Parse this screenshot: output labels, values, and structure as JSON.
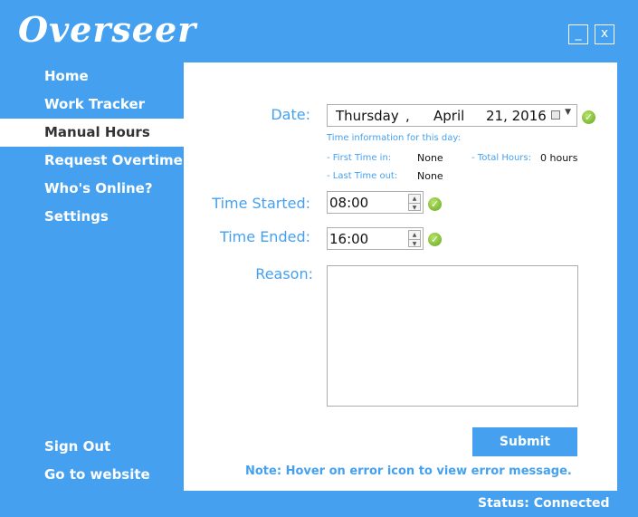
{
  "app": {
    "title": "Overseer"
  },
  "window": {
    "minimize": "_",
    "close": "x"
  },
  "nav": {
    "items": [
      {
        "label": "Home"
      },
      {
        "label": "Work Tracker"
      },
      {
        "label": "Manual Hours"
      },
      {
        "label": "Request Overtime"
      },
      {
        "label": "Who's Online?"
      },
      {
        "label": "Settings"
      }
    ],
    "active": "Manual Hours",
    "sign_out": "Sign Out",
    "go_website": "Go to website"
  },
  "form": {
    "date_label": "Date:",
    "date": {
      "weekday": "Thursday",
      "sep": ",",
      "month": "April",
      "day_year": "21, 2016"
    },
    "info_title": "Time information for this day:",
    "first_time_in_label": "- First Time in:",
    "first_time_in_value": "None",
    "last_time_out_label": "- Last Time out:",
    "last_time_out_value": "None",
    "total_hours_label": "- Total Hours:",
    "total_hours_value": "0 hours",
    "time_started_label": "Time Started:",
    "time_started_value": "08:00",
    "time_ended_label": "Time Ended:",
    "time_ended_value": "16:00",
    "reason_label": "Reason:",
    "reason_value": "",
    "submit_label": "Submit",
    "note": "Note: Hover on error icon to view error message."
  },
  "status": {
    "text": "Status: Connected"
  },
  "icons": {
    "valid": "check-circle-icon",
    "calendar": "calendar-icon"
  },
  "colors": {
    "accent": "#45a1f0",
    "panel": "#ffffff",
    "valid": "#62a81e"
  }
}
